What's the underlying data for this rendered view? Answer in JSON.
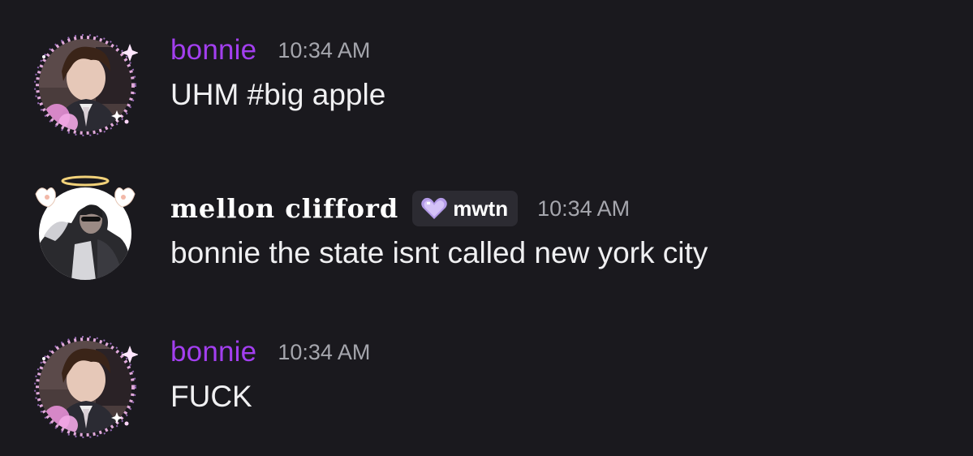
{
  "colors": {
    "background": "#1a191e",
    "bonnie_name": "#a33ff0",
    "timestamp": "#a5a6ad",
    "message_text": "#f0f0f2",
    "tag_background": "#2c2b32"
  },
  "messages": [
    {
      "username": "bonnie",
      "timestamp": "10:34 AM",
      "content": "UHM #big apple",
      "avatar_icon": "profile-photo-sparkle-frame"
    },
    {
      "username": "mellon clifford",
      "tag_icon": "purple-heart-icon",
      "tag_label": "mwtn",
      "timestamp": "10:34 AM",
      "content": "bonnie the state isnt called new york city",
      "avatar_icon": "profile-photo-angel-halo-frame"
    },
    {
      "username": "bonnie",
      "timestamp": "10:34 AM",
      "content": "FUCK",
      "avatar_icon": "profile-photo-sparkle-frame"
    }
  ]
}
